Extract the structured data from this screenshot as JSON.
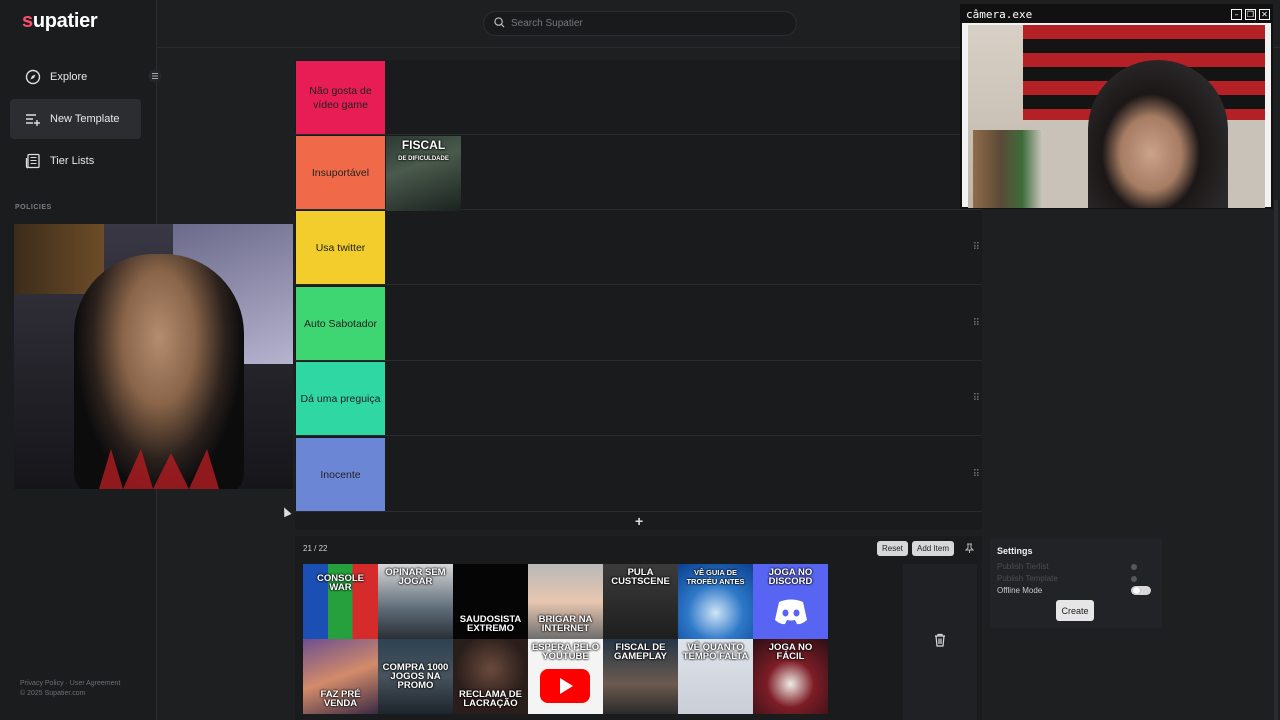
{
  "app": {
    "logo_text": "supatier",
    "logo_first_letter": "s",
    "logo_rest": "upatier"
  },
  "search": {
    "placeholder": "Search Supatier"
  },
  "sidebar": {
    "items": [
      {
        "label": "Explore",
        "icon": "compass-icon"
      },
      {
        "label": "New Template",
        "icon": "list-plus-icon"
      },
      {
        "label": "Tier Lists",
        "icon": "newspaper-icon"
      }
    ],
    "section_label": "POLICIES",
    "footer_links": "Privacy Policy · User Agreement",
    "copyright": "© 2025 Supatier.com"
  },
  "tiers": [
    {
      "label": "Não gosta de vídeo game",
      "color": "#e81d55",
      "items": []
    },
    {
      "label": "Insuportável",
      "color": "#f06a4a",
      "items": [
        {
          "top": "FISCAL",
          "sub": "DE DIFICULDADE"
        }
      ]
    },
    {
      "label": "Usa twitter",
      "color": "#f2cd2c",
      "items": []
    },
    {
      "label": "Auto Sabotador",
      "color": "#3ed673",
      "items": []
    },
    {
      "label": "Dá uma preguiça",
      "color": "#2fd7a2",
      "items": []
    },
    {
      "label": "Inocente",
      "color": "#6c86d6",
      "items": []
    }
  ],
  "add_tier_symbol": "+",
  "pool": {
    "count": "21 / 22",
    "reset_label": "Reset",
    "add_item_label": "Add Item",
    "items": [
      {
        "caption": "CONSOLE WAR",
        "pos": "top"
      },
      {
        "caption": "OPINAR SEM JOGAR",
        "pos": "top"
      },
      {
        "caption": "SAUDOSISTA EXTREMO",
        "pos": "bottom"
      },
      {
        "caption": "BRIGAR NA INTERNET",
        "pos": "bottom"
      },
      {
        "caption": "PULA CUSTSCENE",
        "pos": "top"
      },
      {
        "caption": "VÊ GUIA DE TROFÉU ANTES",
        "pos": "top"
      },
      {
        "caption": "JOGA NO DISCORD",
        "pos": "top"
      },
      {
        "caption": "FAZ PRÉ VENDA",
        "pos": "bottom"
      },
      {
        "caption": "COMPRA 1000 JOGOS NA PROMO",
        "pos": "middle"
      },
      {
        "caption": "RECLAMA DE LACRAÇÃO",
        "pos": "bottom"
      },
      {
        "caption": "ESPERA PELO YOUTUBE",
        "pos": "top"
      },
      {
        "caption": "FISCAL DE GAMEPLAY",
        "pos": "top"
      },
      {
        "caption": "VÊ QUANTO TEMPO FALTA",
        "pos": "top"
      },
      {
        "caption": "JOGA NO FÁCIL",
        "pos": "top"
      }
    ]
  },
  "settings": {
    "title": "Settings",
    "rows": [
      "Publish Tierlist",
      "Publish Template",
      "Offline Mode"
    ],
    "create_label": "Create"
  },
  "camera_window": {
    "title": "câmera.exe"
  },
  "colors": {
    "brand_accent": "#ff4d6d",
    "background": "#1e1f21",
    "panel": "#1a1b1d"
  }
}
